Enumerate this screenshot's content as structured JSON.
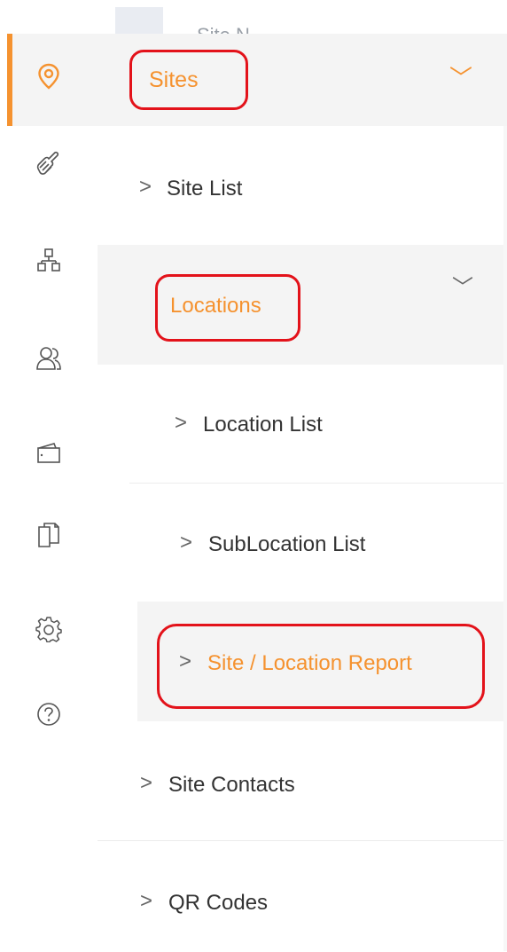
{
  "header": {
    "clipped_text": "Site N"
  },
  "rail": {
    "icons": [
      "location-pin-icon",
      "hand-icon",
      "org-chart-icon",
      "people-icon",
      "wallet-icon",
      "documents-icon",
      "gear-icon",
      "help-icon"
    ]
  },
  "menu": {
    "sites": {
      "label": "Sites",
      "chevron": "﹀"
    },
    "site_list": {
      "label": "Site List",
      "chevron": ">"
    },
    "locations": {
      "label": "Locations",
      "chevron": "﹀"
    },
    "location_list": {
      "label": "Location List",
      "chevron": ">"
    },
    "sublocation_list": {
      "label": "SubLocation List",
      "chevron": ">"
    },
    "site_location_report": {
      "label": "Site / Location Report",
      "chevron": ">"
    },
    "site_contacts": {
      "label": "Site Contacts",
      "chevron": ">"
    },
    "qr_codes": {
      "label": "QR Codes",
      "chevron": ">"
    }
  },
  "colors": {
    "accent": "#f5922f",
    "annotation": "#e3121a",
    "row_highlight": "#f4f4f4"
  }
}
